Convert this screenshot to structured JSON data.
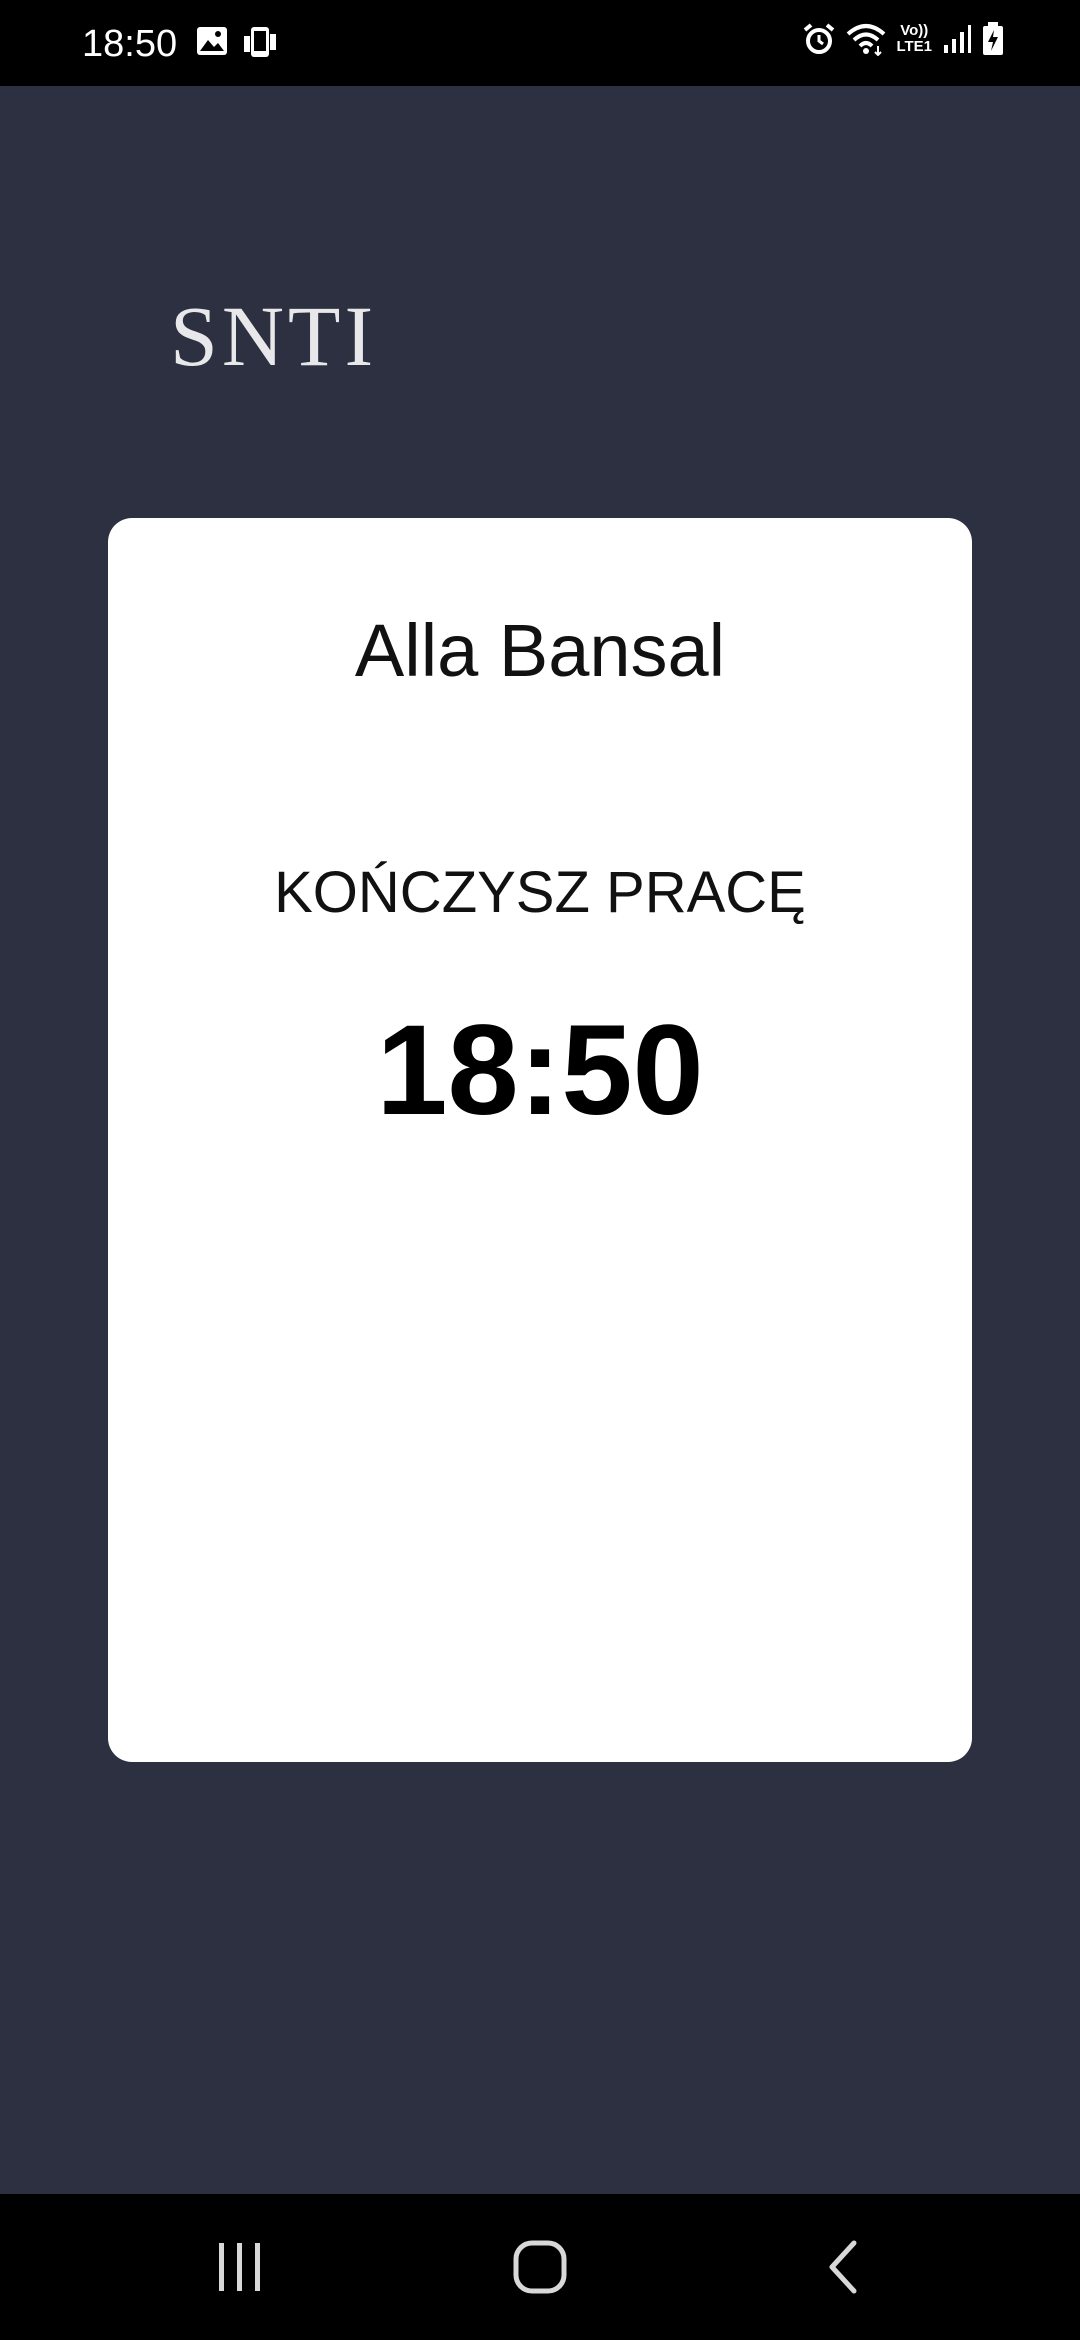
{
  "status_bar": {
    "time": "18:50",
    "left_icons": [
      "image-icon",
      "device-sync-icon"
    ],
    "right_icons": [
      "alarm-icon",
      "wifi-icon",
      "volte-lte-icon",
      "signal-icon",
      "battery-charging-icon"
    ],
    "volte_label_top": "Vo))",
    "volte_label_bottom": "LTE1"
  },
  "app": {
    "logo": "SNTI",
    "card": {
      "employee_name": "Alla Bansal",
      "status_message": "KOŃCZYSZ PRACĘ",
      "time": "18:50"
    }
  },
  "nav_bar": {
    "buttons": [
      "recent-apps-icon",
      "home-icon",
      "back-icon"
    ]
  },
  "colors": {
    "background": "#2c3040",
    "card": "#ffffff",
    "bars": "#000000"
  }
}
